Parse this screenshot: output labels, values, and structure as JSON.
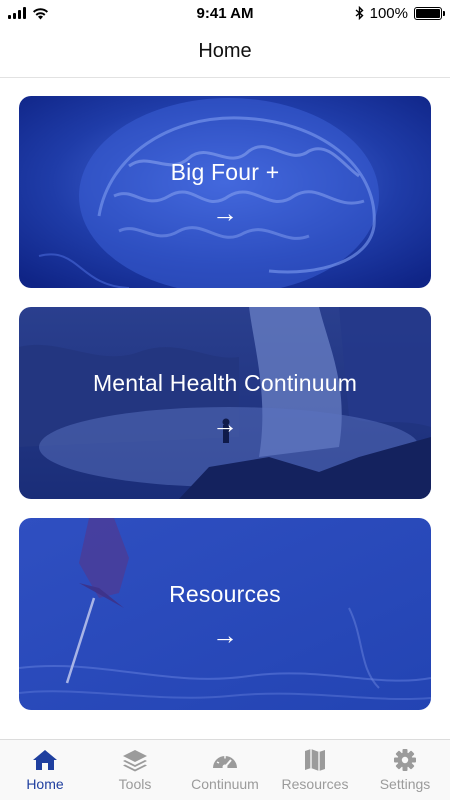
{
  "status_bar": {
    "time": "9:41 AM",
    "battery_percent": "100%"
  },
  "header": {
    "title": "Home"
  },
  "cards": [
    {
      "label": "Big Four +",
      "arrow": "→",
      "image": "brain"
    },
    {
      "label": "Mental Health Continuum",
      "arrow": "→",
      "image": "waterfall-hiker"
    },
    {
      "label": "Resources",
      "arrow": "→",
      "image": "map-pin"
    }
  ],
  "tabs": [
    {
      "label": "Home",
      "icon": "house-icon",
      "active": true
    },
    {
      "label": "Tools",
      "icon": "layers-icon",
      "active": false
    },
    {
      "label": "Continuum",
      "icon": "gauge-icon",
      "active": false
    },
    {
      "label": "Resources",
      "icon": "map-icon",
      "active": false
    },
    {
      "label": "Settings",
      "icon": "gear-icon",
      "active": false
    }
  ],
  "colors": {
    "active_tab": "#1f3f9f",
    "inactive_tab": "#9b9b9b",
    "card_overlay": "#1e3c9c"
  }
}
